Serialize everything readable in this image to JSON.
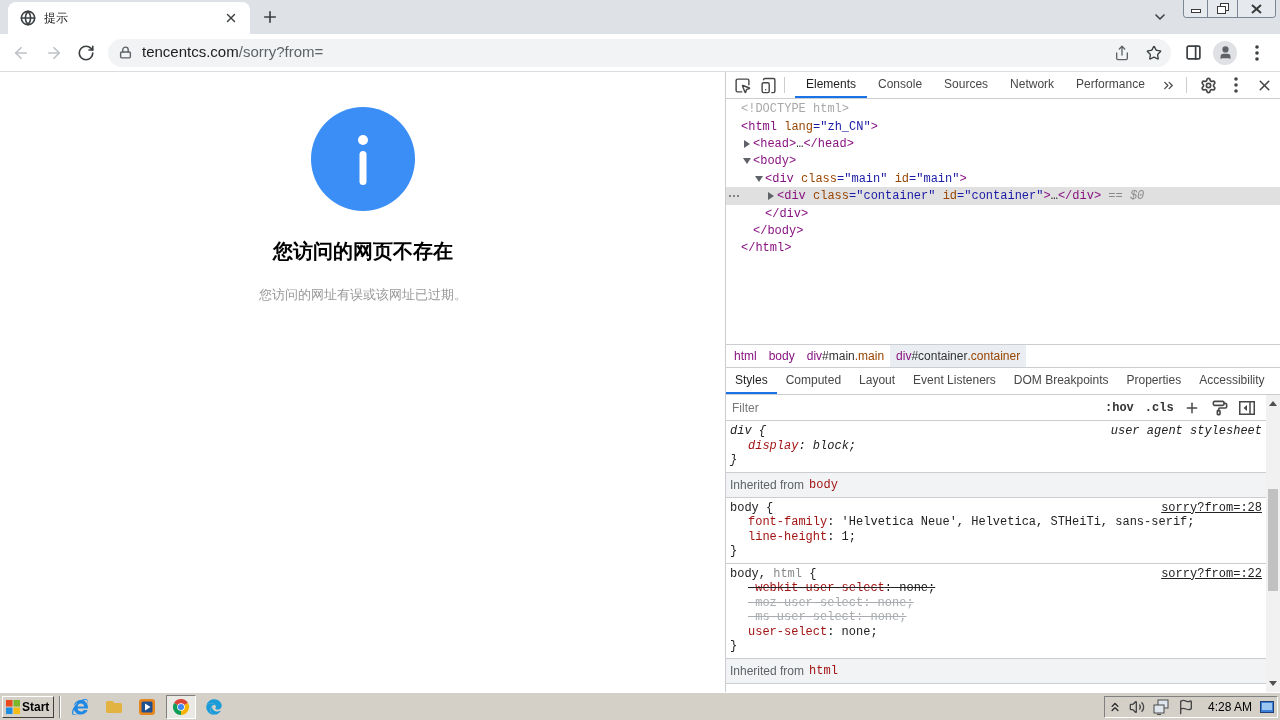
{
  "browser": {
    "tabs": [
      {
        "title": "提示",
        "selected": true
      }
    ],
    "nav_buttons": [
      {
        "kind": "back",
        "disabled": true
      },
      {
        "kind": "forward",
        "disabled": true
      },
      {
        "kind": "reload",
        "disabled": false
      }
    ],
    "address": {
      "host": "tencentcs.com",
      "path": "/sorry?from="
    }
  },
  "page": {
    "title": "您访问的网页不存在",
    "message": "您访问的网址有误或该网址已过期。"
  },
  "devtools": {
    "tabs": [
      {
        "label": "Elements",
        "selected": true
      },
      {
        "label": "Console",
        "selected": false
      },
      {
        "label": "Sources",
        "selected": false
      },
      {
        "label": "Network",
        "selected": false
      },
      {
        "label": "Performance",
        "selected": false
      }
    ],
    "dom_tree": [
      {
        "selected": false,
        "tokens": [
          {
            "kind": "comment",
            "text": "<!DOCTYPE html>"
          }
        ]
      },
      {
        "selected": false,
        "tokens": [
          {
            "kind": "tag",
            "text": "<html"
          },
          {
            "kind": "attr",
            "text": " lang"
          },
          {
            "kind": "value",
            "text": "=\"zh_CN\""
          },
          {
            "kind": "tag",
            "text": ">"
          }
        ],
        "children": [
          {
            "selected": false,
            "expanded": false,
            "tokens": [
              {
                "kind": "tag",
                "text": "<head>"
              },
              {
                "kind": "text",
                "text": "…"
              },
              {
                "kind": "tag",
                "text": "</head>"
              }
            ]
          },
          {
            "selected": false,
            "expanded": true,
            "tokens": [
              {
                "kind": "tag",
                "text": "<body>"
              }
            ],
            "children": [
              {
                "selected": false,
                "expanded": true,
                "tokens": [
                  {
                    "kind": "tag",
                    "text": "<div"
                  },
                  {
                    "kind": "attr",
                    "text": " class"
                  },
                  {
                    "kind": "value",
                    "text": "=\"main\""
                  },
                  {
                    "kind": "attr",
                    "text": " id"
                  },
                  {
                    "kind": "value",
                    "text": "=\"main\""
                  },
                  {
                    "kind": "tag",
                    "text": ">"
                  }
                ],
                "children": [
                  {
                    "selected": true,
                    "expanded": false,
                    "tokens": [
                      {
                        "kind": "tag",
                        "text": "<div"
                      },
                      {
                        "kind": "attr",
                        "text": " class"
                      },
                      {
                        "kind": "value",
                        "text": "=\"container\""
                      },
                      {
                        "kind": "attr",
                        "text": " id"
                      },
                      {
                        "kind": "value",
                        "text": "=\"container\""
                      },
                      {
                        "kind": "tag",
                        "text": ">"
                      },
                      {
                        "kind": "text",
                        "text": "…"
                      },
                      {
                        "kind": "tag",
                        "text": "</div>"
                      },
                      {
                        "kind": "hint",
                        "text": " == $0"
                      }
                    ]
                  }
                ],
                "close": [
                  {
                    "kind": "tag",
                    "text": "</div>"
                  }
                ]
              }
            ],
            "close": [
              {
                "kind": "tag",
                "text": "</body>"
              }
            ]
          }
        ],
        "close": [
          {
            "kind": "tag",
            "text": "</html>"
          }
        ]
      }
    ],
    "breadcrumbs": [
      {
        "selected": false,
        "parts": [
          {
            "kind": "tag",
            "text": "html"
          }
        ]
      },
      {
        "selected": false,
        "parts": [
          {
            "kind": "tag",
            "text": "body"
          }
        ]
      },
      {
        "selected": false,
        "parts": [
          {
            "kind": "tag",
            "text": "div"
          },
          {
            "kind": "id",
            "text": "#main"
          },
          {
            "kind": "class",
            "text": ".main"
          }
        ]
      },
      {
        "selected": true,
        "parts": [
          {
            "kind": "tag",
            "text": "div"
          },
          {
            "kind": "id",
            "text": "#container"
          },
          {
            "kind": "class",
            "text": ".container"
          }
        ]
      }
    ],
    "styles": {
      "tabs": [
        {
          "label": "Styles",
          "selected": true
        },
        {
          "label": "Computed",
          "selected": false
        },
        {
          "label": "Layout",
          "selected": false
        },
        {
          "label": "Event Listeners",
          "selected": false
        },
        {
          "label": "DOM Breakpoints",
          "selected": false
        },
        {
          "label": "Properties",
          "selected": false
        },
        {
          "label": "Accessibility",
          "selected": false
        }
      ],
      "filter": {
        "placeholder": "Filter"
      },
      "toggles": [
        ":hov",
        ".cls"
      ],
      "sections": [
        {
          "kind": "ua_rule",
          "selector": [
            {
              "text": "div {",
              "matched": true
            }
          ],
          "source": "user agent stylesheet",
          "declarations": [
            {
              "name": "display",
              "value": ": block;",
              "struck": false,
              "dim": false
            }
          ],
          "close": "}"
        },
        {
          "kind": "inherited",
          "label": "Inherited from",
          "node": "body"
        },
        {
          "kind": "rule",
          "selector": [
            {
              "text": "body {",
              "matched": true
            }
          ],
          "source": "sorry?from=:28",
          "declarations": [
            {
              "name": "font-family",
              "value": ": 'Helvetica Neue', Helvetica, STHeiTi, sans-serif;",
              "struck": false,
              "dim": false
            },
            {
              "name": "line-height",
              "value": ": 1;",
              "struck": false,
              "dim": false
            }
          ],
          "close": "}"
        },
        {
          "kind": "rule",
          "selector": [
            {
              "text": "body, ",
              "matched": true
            },
            {
              "text": "html",
              "matched": false
            },
            {
              "text": " {",
              "matched": true
            }
          ],
          "source": "sorry?from=:22",
          "declarations": [
            {
              "name": "-webkit-user-select",
              "value": ": none;",
              "struck": true,
              "dim": false
            },
            {
              "name": "-moz-user-select",
              "value": ": none;",
              "struck": true,
              "dim": true
            },
            {
              "name": "-ms-user-select",
              "value": ": none;",
              "struck": true,
              "dim": true
            },
            {
              "name": "user-select",
              "value": ": none;",
              "struck": false,
              "dim": false
            }
          ],
          "close": "}"
        },
        {
          "kind": "inherited",
          "label": "Inherited from",
          "node": "html"
        }
      ]
    }
  },
  "taskbar": {
    "start": "Start",
    "apps": [
      {
        "kind": "ie",
        "active": false
      },
      {
        "kind": "folder",
        "active": false
      },
      {
        "kind": "media",
        "active": false
      },
      {
        "kind": "chrome",
        "active": true
      },
      {
        "kind": "edge",
        "active": false
      }
    ],
    "clock": "4:28 AM"
  }
}
